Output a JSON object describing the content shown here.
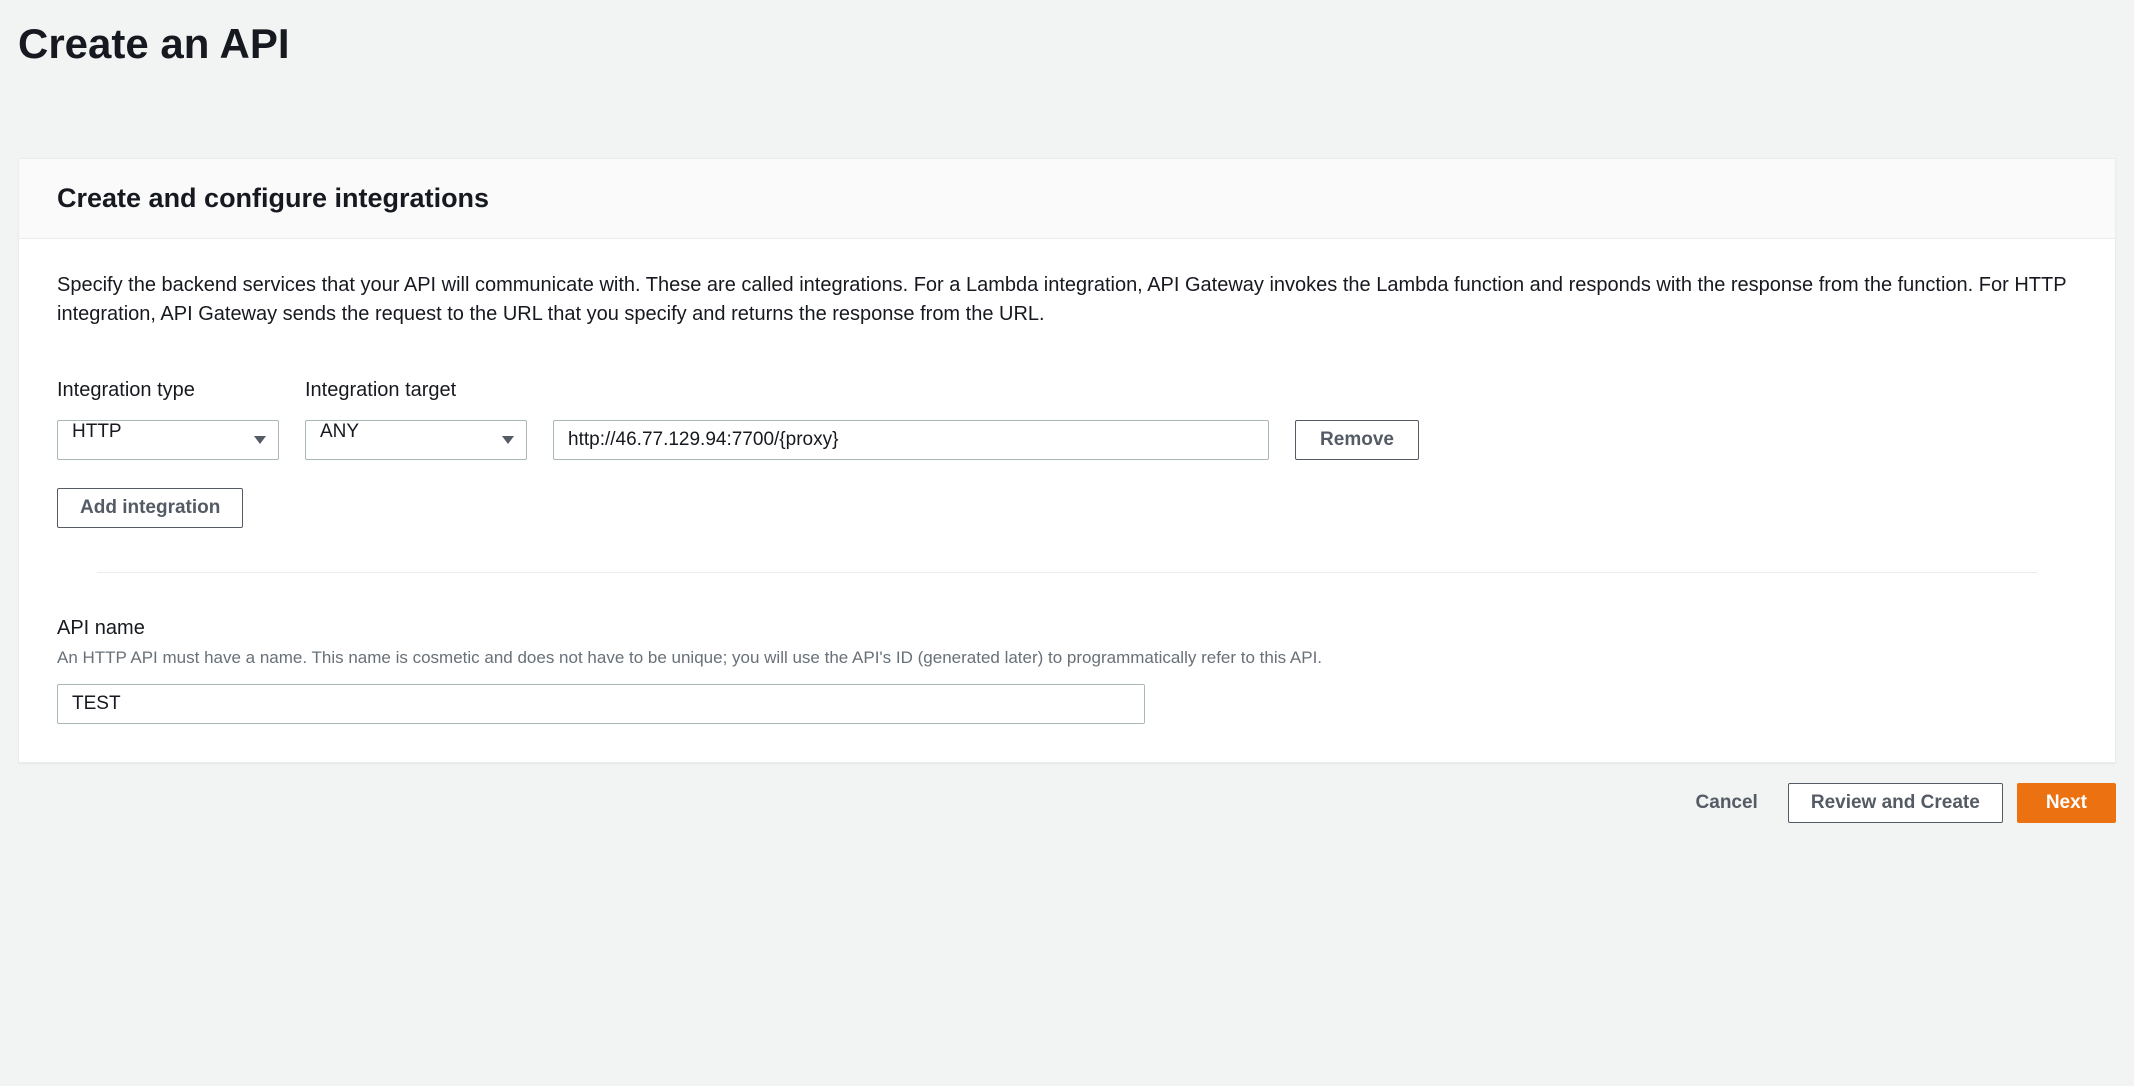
{
  "page": {
    "title": "Create an API"
  },
  "panel": {
    "heading": "Create and configure integrations",
    "description": "Specify the backend services that your API will communicate with. These are called integrations. For a Lambda integration, API Gateway invokes the Lambda function and responds with the response from the function. For HTTP integration, API Gateway sends the request to the URL that you specify and returns the response from the URL."
  },
  "columns": {
    "type_label": "Integration type",
    "target_label": "Integration target"
  },
  "integration": {
    "type_value": "HTTP",
    "method_value": "ANY",
    "url_value": "http://46.77.129.94:7700/{proxy}",
    "remove_label": "Remove"
  },
  "add_integration_label": "Add integration",
  "api_name": {
    "label": "API name",
    "hint": "An HTTP API must have a name. This name is cosmetic and does not have to be unique; you will use the API's ID (generated later) to programmatically refer to this API.",
    "value": "TEST"
  },
  "footer": {
    "cancel": "Cancel",
    "review": "Review and Create",
    "next": "Next"
  }
}
